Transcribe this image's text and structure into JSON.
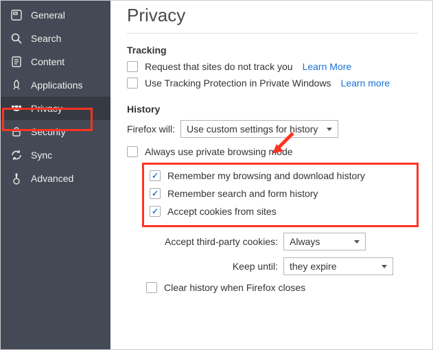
{
  "sidebar": {
    "items": [
      {
        "label": "General"
      },
      {
        "label": "Search"
      },
      {
        "label": "Content"
      },
      {
        "label": "Applications"
      },
      {
        "label": "Privacy"
      },
      {
        "label": "Security"
      },
      {
        "label": "Sync"
      },
      {
        "label": "Advanced"
      }
    ]
  },
  "page": {
    "title": "Privacy"
  },
  "tracking": {
    "heading": "Tracking",
    "doNotTrack": "Request that sites do not track you",
    "doNotTrackLink": "Learn More",
    "trackingProtection": "Use Tracking Protection in Private Windows",
    "trackingProtectionLink": "Learn more"
  },
  "history": {
    "heading": "History",
    "willLabel": "Firefox will:",
    "willValue": "Use custom settings for history",
    "alwaysPrivate": "Always use private browsing mode",
    "rememberBrowsing": "Remember my browsing and download history",
    "rememberSearch": "Remember search and form history",
    "acceptCookies": "Accept cookies from sites",
    "thirdPartyLabel": "Accept third-party cookies:",
    "thirdPartyValue": "Always",
    "keepUntilLabel": "Keep until:",
    "keepUntilValue": "they expire",
    "clearOnClose": "Clear history when Firefox closes"
  }
}
